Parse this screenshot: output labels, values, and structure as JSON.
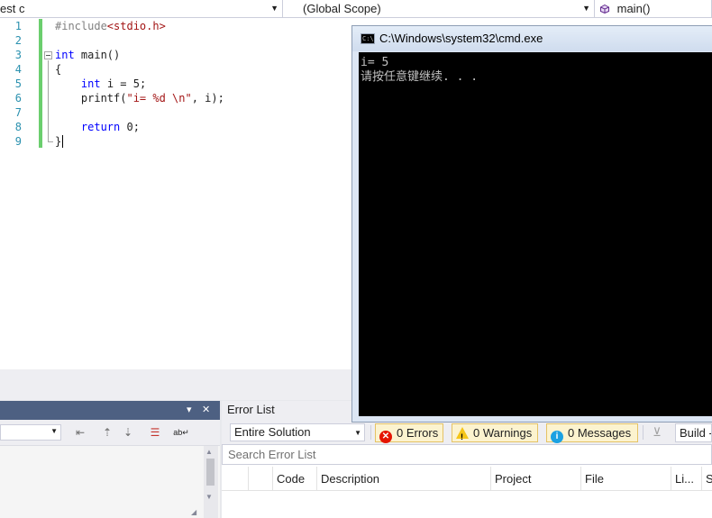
{
  "navbar": {
    "project": "est c",
    "scope": "(Global Scope)",
    "member": "main()"
  },
  "editor": {
    "line_numbers": [
      "1",
      "2",
      "3",
      "4",
      "5",
      "6",
      "7",
      "8",
      "9"
    ],
    "code": {
      "l1_directive": "#include",
      "l1_header": "<stdio.h>",
      "l3_type": "int",
      "l3_rest": " main()",
      "l4": "{",
      "l5_indent": "    ",
      "l5_type": "int",
      "l5_rest": " i = 5;",
      "l6_pre": "    printf(",
      "l6_str": "\"i= %d \\n\"",
      "l6_post": ", i);",
      "l8_indent": "    ",
      "l8_kw": "return",
      "l8_rest": " 0;",
      "l9": "}"
    }
  },
  "cmd": {
    "title": "C:\\Windows\\system32\\cmd.exe",
    "icon_text": "C:\\",
    "lines": [
      "i= 5",
      "请按任意键继续. . ."
    ]
  },
  "left_panel": {
    "window_position_glyph": "▾",
    "close_glyph": "✕"
  },
  "error_list": {
    "title": "Error List",
    "scope_value": "Entire Solution",
    "errors_label": "0 Errors",
    "warnings_label": "0 Warnings",
    "messages_label": "0 Messages",
    "build_value": "Build -",
    "search_placeholder": "Search Error List",
    "columns": [
      "Code",
      "Description",
      "Project",
      "File",
      "Li...",
      "S"
    ]
  },
  "colors": {
    "keyword": "#0000ff",
    "string": "#a31515",
    "preprocessor": "#808080",
    "line_number": "#2b91af",
    "change_bar": "#6bce6e",
    "tool_window_title": "#4d6082",
    "console_bg": "#000000",
    "console_fg": "#c0c0c0"
  },
  "icons": [
    "method-icon",
    "outline-collapse-icon",
    "cmd-icon",
    "error-icon",
    "warning-icon",
    "info-icon",
    "filter-icon",
    "dropdown-arrow-icon"
  ]
}
